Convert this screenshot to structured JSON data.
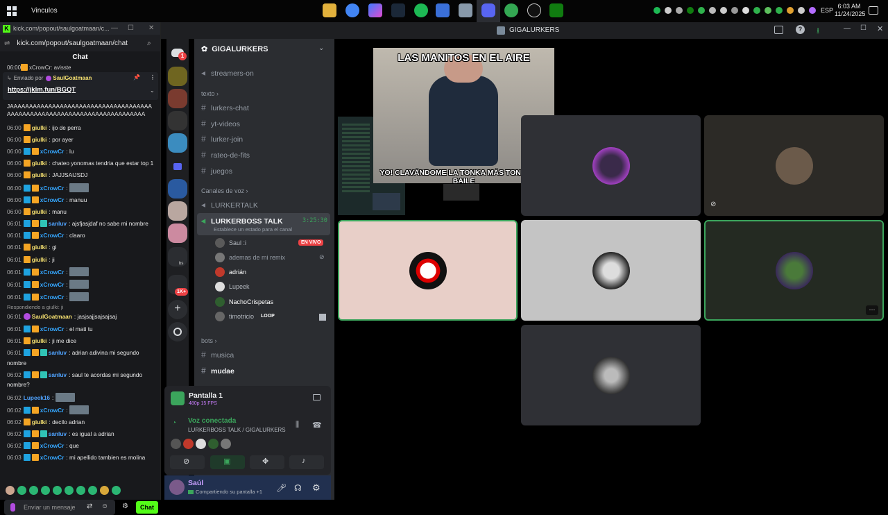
{
  "taskbar": {
    "title": "Vinculos",
    "lang": "ESP",
    "time": "6:03 AM",
    "date": "11/24/2025"
  },
  "kick": {
    "tab_title": "kick.com/popout/saulgoatmaan/c...",
    "url": "kick.com/popout/saulgoatmaan/chat",
    "chat_header": "Chat",
    "partial_top": "xCrowCr: avisste",
    "pinned": {
      "sent_by": "Enviado por",
      "user": "SaulGoatmaan",
      "link": "https://jklm.fun/BGQT"
    },
    "long_a": "JAAAAAAAAAAAAAAAAAAAAAAAAAAAAAAAAAAAAAAAAAAAAAAAAAAAAAAAAAAAAAAAAAAAAAAAAA",
    "messages": [
      {
        "time": "06:00",
        "user": "giulki",
        "text": "ijo de perra",
        "color": "#f5e070"
      },
      {
        "time": "06:00",
        "user": "giulki",
        "text": "por ayer",
        "color": "#f5e070"
      },
      {
        "time": "06:00",
        "user": "xCrowCr",
        "text": "lu",
        "color": "#35a7ff"
      },
      {
        "time": "06:00",
        "user": "giulki",
        "text": "chateo yonomas tendria que estar top 1",
        "color": "#f5e070"
      },
      {
        "time": "06:00",
        "user": "giulki",
        "text": "JAJJSAIJSDJ",
        "color": "#f5e070"
      },
      {
        "time": "06:00",
        "user": "xCrowCr",
        "text": "",
        "color": "#35a7ff"
      },
      {
        "time": "06:00",
        "user": "xCrowCr",
        "text": "manuu",
        "color": "#35a7ff"
      },
      {
        "time": "06:00",
        "user": "giulki",
        "text": "manu",
        "color": "#f5e070"
      },
      {
        "time": "06:01",
        "user": "sanluv",
        "text": "ajsfjasjdaf no sabe mi nombre",
        "color": "#4fa3ff"
      },
      {
        "time": "06:01",
        "user": "xCrowCr",
        "text": "claaro",
        "color": "#35a7ff"
      },
      {
        "time": "06:01",
        "user": "giulki",
        "text": "gi",
        "color": "#f5e070"
      },
      {
        "time": "06:01",
        "user": "giulki",
        "text": "ji",
        "color": "#f5e070"
      },
      {
        "time": "06:01",
        "user": "xCrowCr",
        "text": "",
        "color": "#35a7ff"
      },
      {
        "time": "06:01",
        "user": "xCrowCr",
        "text": "",
        "color": "#35a7ff"
      },
      {
        "time": "06:01",
        "user": "xCrowCr",
        "text": "",
        "color": "#35a7ff"
      }
    ],
    "reply_note": "Respondiendo a giulki: ji",
    "messages2": [
      {
        "time": "06:01",
        "user": "SaulGoatmaan",
        "text": "jasjsajjsajsajsaj",
        "color": "#f5e070"
      },
      {
        "time": "06:01",
        "user": "xCrowCr",
        "text": "el mati tu",
        "color": "#35a7ff"
      },
      {
        "time": "06:01",
        "user": "giulki",
        "text": "ji me dice",
        "color": "#f5e070"
      },
      {
        "time": "06:01",
        "user": "sanluv",
        "text": "adrian adivina mi segundo",
        "color": "#4fa3ff",
        "cont": "nombre"
      },
      {
        "time": "06:02",
        "user": "sanluv",
        "text": "saul te acordas mi segundo",
        "color": "#4fa3ff",
        "cont": "nombre?"
      },
      {
        "time": "06:02",
        "user": "Lupeek16",
        "text": "",
        "color": "#4fa3ff"
      },
      {
        "time": "06:02",
        "user": "xCrowCr",
        "text": "",
        "color": "#35a7ff"
      },
      {
        "time": "06:02",
        "user": "giulki",
        "text": "decilo adrian",
        "color": "#f5e070"
      },
      {
        "time": "06:02",
        "user": "sanluv",
        "text": "es igual a adrian",
        "color": "#4fa3ff"
      },
      {
        "time": "06:02",
        "user": "xCrowCr",
        "text": "que",
        "color": "#35a7ff"
      },
      {
        "time": "06:03",
        "user": "xCrowCr",
        "text": "mi apellido tambien es molina",
        "color": "#35a7ff"
      }
    ],
    "input_placeholder": "Enviar un mensaje",
    "chat_button": "Chat"
  },
  "discord": {
    "window_title": "GIGALURKERS",
    "server_name": "GIGALURKERS",
    "rail_badges": {
      "mention": "1",
      "bs": "bs",
      "count": "1K+"
    },
    "channels": {
      "top": "streamers-on",
      "text_cat": "texto",
      "text": [
        "lurkers-chat",
        "yt-videos",
        "lurker-join",
        "rateo-de-fits",
        "juegos"
      ],
      "voice_cat": "Canales de voz",
      "voice": [
        "LURKERTALK",
        "LURKERBOSS TALK"
      ],
      "voice_timer": "3:25:30",
      "voice_status": "Establece un estado para el canal",
      "bots_cat": "bots",
      "bots": [
        "musica",
        "mudae"
      ]
    },
    "voice_users": [
      {
        "name": "Saul :i",
        "badge": "EN VIVO",
        "color": "#b5bac1"
      },
      {
        "name": "ademas de mi remix",
        "color": "#949ba4"
      },
      {
        "name": "adrián",
        "color": "#ffffff"
      },
      {
        "name": "Lupeek",
        "color": "#b5bac1"
      },
      {
        "name": "NachoCrispetas",
        "color": "#ffffff"
      },
      {
        "name": "timotricio",
        "badge": "LOOP",
        "color": "#b5bac1"
      }
    ],
    "stream": {
      "title": "Pantalla 1",
      "quality": "480p 15 FPS"
    },
    "voice_conn": {
      "status": "Voz conectada",
      "channel": "LURKERBOSS TALK / GIGALURKERS"
    },
    "user_panel": {
      "name": "Saúl",
      "status": "Compartiendo su pantalla +1"
    },
    "meme": {
      "top": "LAS MANITOS EN EL AIRE",
      "bottom": "YO! CLAVÁNDOME LA TONKA MÁS TONKA DEL BAILE"
    }
  },
  "colors": {
    "accent_green": "#3ba55c",
    "discord_blurple": "#5865f2",
    "kick_green": "#53fc18",
    "live_red": "#ed4245"
  }
}
